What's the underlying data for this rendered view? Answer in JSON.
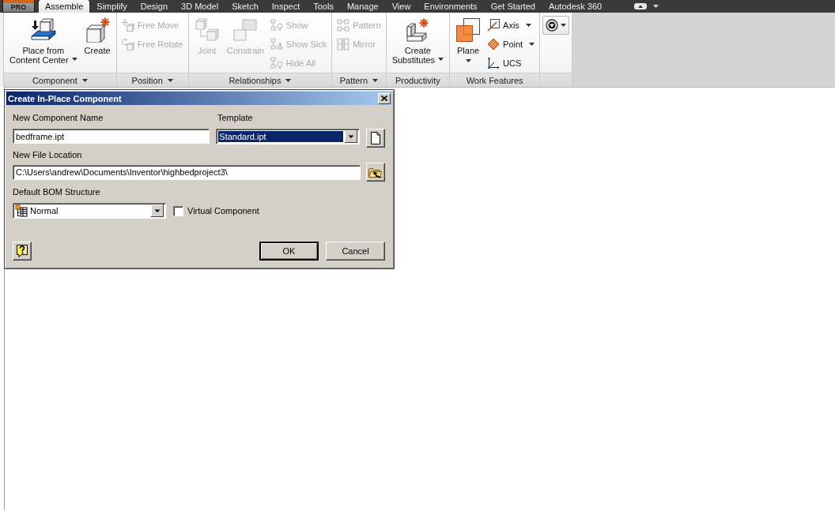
{
  "app_button": {
    "label": "PRO"
  },
  "tabs": [
    {
      "label": "Assemble",
      "selected": true
    },
    {
      "label": "Simplify",
      "selected": false
    },
    {
      "label": "Design",
      "selected": false
    },
    {
      "label": "3D Model",
      "selected": false
    },
    {
      "label": "Sketch",
      "selected": false
    },
    {
      "label": "Inspect",
      "selected": false
    },
    {
      "label": "Tools",
      "selected": false
    },
    {
      "label": "Manage",
      "selected": false
    },
    {
      "label": "View",
      "selected": false
    },
    {
      "label": "Environments",
      "selected": false
    },
    {
      "label": "Get Started",
      "selected": false
    },
    {
      "label": "Autodesk 360",
      "selected": false
    }
  ],
  "ribbon": {
    "panels": [
      {
        "title": "Component",
        "has_menu": true,
        "controls": [
          {
            "kind": "large",
            "label": "Place from Content Center",
            "disabled": false,
            "has_dropdown": true
          },
          {
            "kind": "large",
            "label": "Create",
            "disabled": false,
            "has_dropdown": false
          }
        ]
      },
      {
        "title": "Position",
        "has_menu": true,
        "controls": [
          {
            "kind": "small",
            "label": "Free Move",
            "disabled": true,
            "has_dropdown": false
          },
          {
            "kind": "small",
            "label": "Free Rotate",
            "disabled": true,
            "has_dropdown": false
          }
        ]
      },
      {
        "title": "Relationships",
        "has_menu": true,
        "controls": [
          {
            "kind": "large",
            "label": "Joint",
            "disabled": true,
            "has_dropdown": false
          },
          {
            "kind": "large",
            "label": "Constrain",
            "disabled": true,
            "has_dropdown": false
          },
          {
            "kind": "small",
            "label": "Show",
            "disabled": true,
            "has_dropdown": false
          },
          {
            "kind": "small",
            "label": "Show Sick",
            "disabled": true,
            "has_dropdown": false
          },
          {
            "kind": "small",
            "label": "Hide All",
            "disabled": true,
            "has_dropdown": false
          }
        ]
      },
      {
        "title": "Pattern",
        "has_menu": true,
        "controls": [
          {
            "kind": "small",
            "label": "Pattern",
            "disabled": true,
            "has_dropdown": false
          },
          {
            "kind": "small",
            "label": "Mirror",
            "disabled": true,
            "has_dropdown": false
          }
        ]
      },
      {
        "title": "Productivity",
        "has_menu": false,
        "controls": [
          {
            "kind": "large",
            "label": "Create Substitutes",
            "disabled": false,
            "has_dropdown": true
          }
        ]
      },
      {
        "title": "Work Features",
        "has_menu": false,
        "controls": [
          {
            "kind": "large_split",
            "label": "Plane",
            "disabled": false,
            "has_dropdown": true
          },
          {
            "kind": "small",
            "label": "Axis",
            "disabled": false,
            "has_dropdown": true
          },
          {
            "kind": "small",
            "label": "Point",
            "disabled": false,
            "has_dropdown": true
          },
          {
            "kind": "small",
            "label": "UCS",
            "disabled": false,
            "has_dropdown": false
          }
        ]
      },
      {
        "controls": [
          {
            "kind": "icon",
            "disabled": false,
            "has_dropdown": true
          }
        ]
      }
    ]
  },
  "dialog": {
    "title": "Create In-Place Component",
    "component_name": {
      "label": "New Component Name",
      "value": "bedframe.ipt"
    },
    "template": {
      "label": "Template",
      "value": "Standard.ipt",
      "focused": true
    },
    "file_location": {
      "label": "New File Location",
      "value": "C:\\Users\\andrew\\Documents\\Inventor\\highbedproject3\\"
    },
    "bom_structure": {
      "label": "Default BOM Structure",
      "value": "Normal"
    },
    "virtual_component": {
      "label": "Virtual Component",
      "checked": false
    },
    "buttons": [
      {
        "label": "OK",
        "default": true
      },
      {
        "label": "Cancel",
        "default": false
      }
    ]
  }
}
